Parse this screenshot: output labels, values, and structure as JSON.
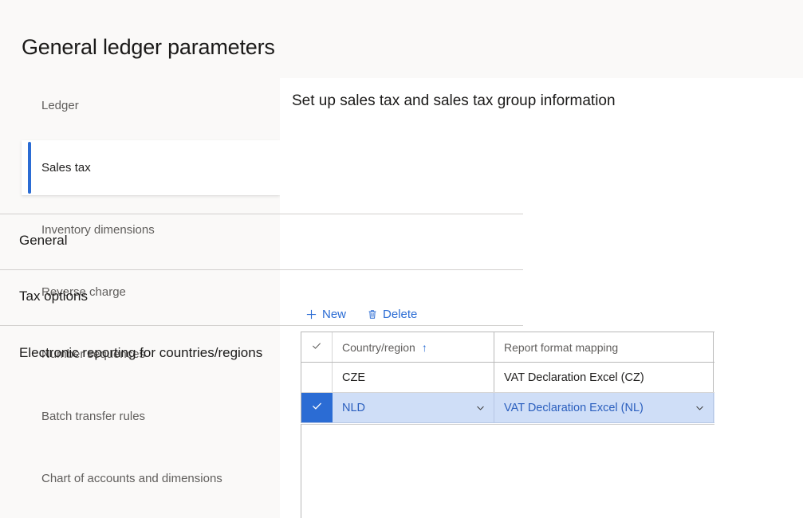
{
  "page": {
    "title": "General ledger parameters",
    "background_color": "#faf9f8",
    "accent_color": "#2b6cd4"
  },
  "sidebar": {
    "items": [
      {
        "label": "Ledger",
        "selected": false
      },
      {
        "label": "Sales tax",
        "selected": true
      },
      {
        "label": "Inventory dimensions",
        "selected": false
      },
      {
        "label": "Reverse charge",
        "selected": false
      },
      {
        "label": "Number sequences",
        "selected": false
      },
      {
        "label": "Batch transfer rules",
        "selected": false
      },
      {
        "label": "Chart of accounts and dimensions",
        "selected": false
      }
    ]
  },
  "content": {
    "title": "Set up sales tax and sales tax group information",
    "sections": [
      {
        "title": "General"
      },
      {
        "title": "Tax options"
      },
      {
        "title": "Electronic reporting for countries/regions"
      }
    ]
  },
  "toolbar": {
    "new_label": "New",
    "new_icon": "plus-icon",
    "delete_label": "Delete",
    "delete_icon": "trash-icon"
  },
  "grid": {
    "select_all_icon": "checkmark-icon",
    "columns": [
      {
        "label": "Country/region",
        "sort": "ascending",
        "sort_icon": "arrow-up-icon"
      },
      {
        "label": "Report format mapping",
        "sort": "none"
      }
    ],
    "rows": [
      {
        "selected": false,
        "country": "CZE",
        "mapping": "VAT Declaration Excel (CZ)"
      },
      {
        "selected": true,
        "country": "NLD",
        "mapping": "VAT Declaration Excel (NL)"
      }
    ],
    "selected_row_background": "#cfdef7",
    "selected_check_background": "#2b6cd4"
  }
}
